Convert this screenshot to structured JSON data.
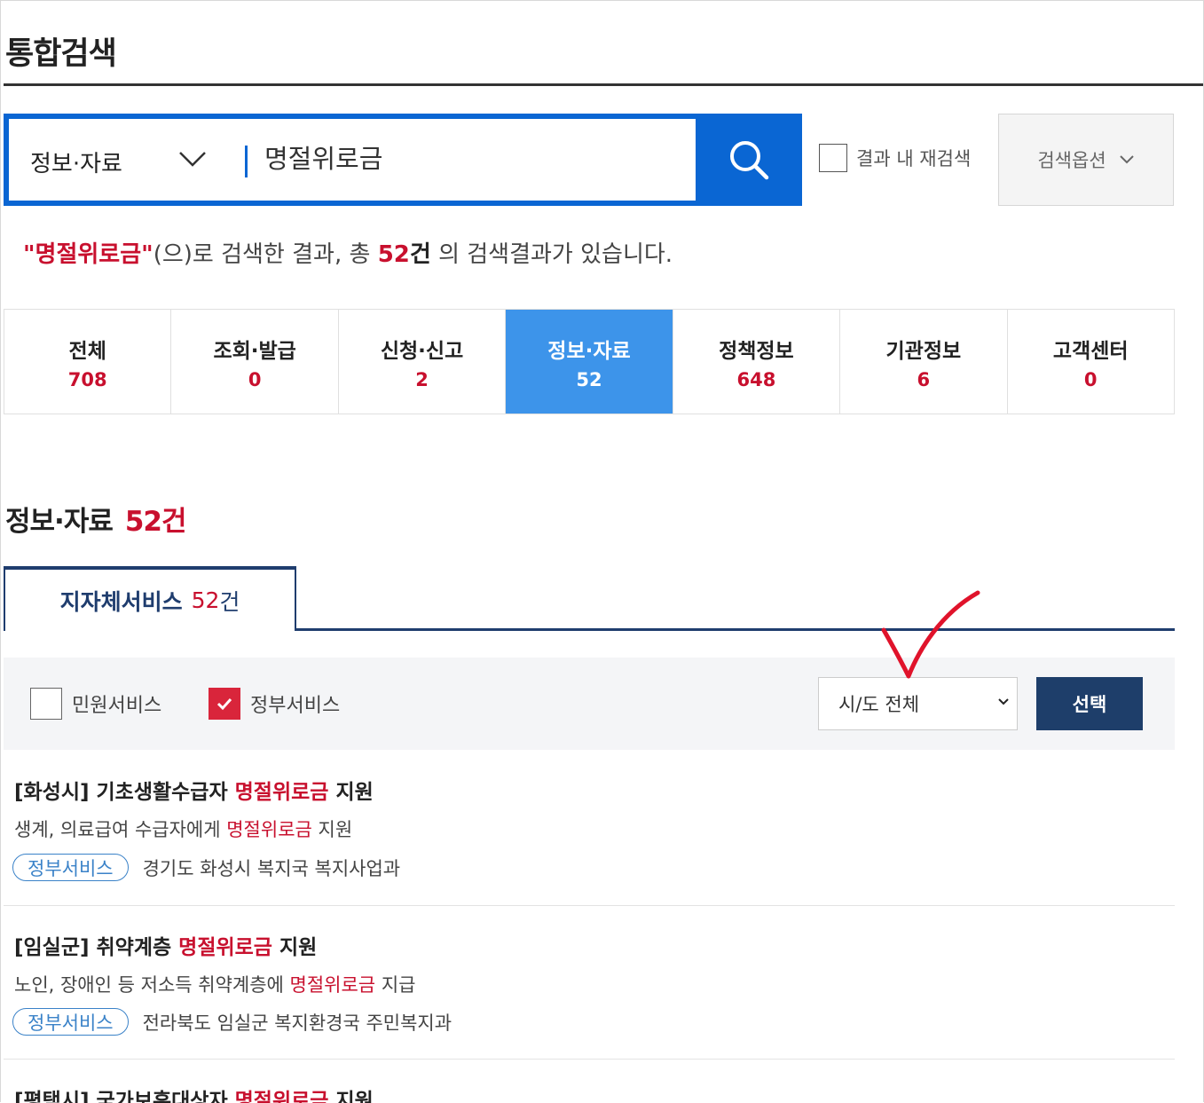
{
  "page_title": "통합검색",
  "search": {
    "category": "정보·자료",
    "query": "명절위로금",
    "research_label": "결과 내 재검색",
    "options_label": "검색옵션"
  },
  "summary": {
    "keyword": "\"명절위로금\"",
    "mid": "(으)로 검색한 결과, 총",
    "count": "52",
    "unit": "건",
    "tail": "의 검색결과가 있습니다."
  },
  "category_tabs": [
    {
      "name": "전체",
      "count": "708"
    },
    {
      "name": "조회·발급",
      "count": "0"
    },
    {
      "name": "신청·신고",
      "count": "2"
    },
    {
      "name": "정보·자료",
      "count": "52",
      "active": true
    },
    {
      "name": "정책정보",
      "count": "648"
    },
    {
      "name": "기관정보",
      "count": "6"
    },
    {
      "name": "고객센터",
      "count": "0"
    }
  ],
  "section": {
    "title": "정보·자료",
    "count": "52건"
  },
  "sub_tab": {
    "label": "지자체서비스",
    "count": "52",
    "unit": "건"
  },
  "filters": {
    "civil_label": "민원서비스",
    "civil_checked": false,
    "gov_label": "정부서비스",
    "gov_checked": true,
    "region_value": "시/도 전체",
    "select_label": "선택"
  },
  "results": [
    {
      "title_pre": "[화성시] 기초생활수급자 ",
      "title_hl": "명절위로금",
      "title_post": " 지원",
      "desc_pre": "생계, 의료급여 수급자에게 ",
      "desc_hl": "명절위로금",
      "desc_post": " 지원",
      "badge": "정부서비스",
      "org": "경기도 화성시 복지국 복지사업과"
    },
    {
      "title_pre": "[임실군] 취약계층 ",
      "title_hl": "명절위로금",
      "title_post": " 지원",
      "desc_pre": "노인, 장애인 등 저소득 취약계층에 ",
      "desc_hl": "명절위로금",
      "desc_post": " 지급",
      "badge": "정부서비스",
      "org": "전라북도 임실군 복지환경국 주민복지과"
    },
    {
      "title_pre": "[평택시] 국가보훈대상자 ",
      "title_hl": "명절위로금",
      "title_post": " 지원"
    }
  ],
  "colors": {
    "brand_blue": "#0a66d3",
    "active_tab": "#3d94ea",
    "highlight_red": "#c8102e",
    "navy": "#1e3e6a"
  }
}
